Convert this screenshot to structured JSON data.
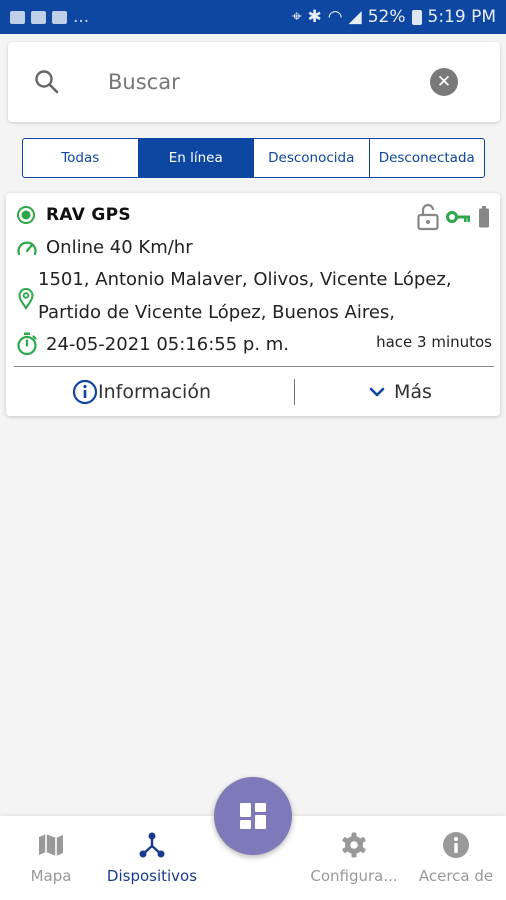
{
  "status_bar": {
    "battery": "52%",
    "time": "5:19 PM"
  },
  "search": {
    "placeholder": "Buscar"
  },
  "tabs": [
    {
      "label": "Todas"
    },
    {
      "label": "En línea"
    },
    {
      "label": "Desconocida"
    },
    {
      "label": "Desconectada"
    }
  ],
  "device": {
    "name": "RAV GPS",
    "speed_status": "Online 40 Km/hr",
    "address": "1501, Antonio Malaver, Olivos, Vicente López, Partido de Vicente López, Buenos Aires,",
    "datetime": "24-05-2021 05:16:55 p. m.",
    "ago": "hace 3 minutos",
    "info_label": "Información",
    "more_label": "Más"
  },
  "bottom_nav": {
    "items": [
      {
        "label": "Mapa",
        "icon": "map-icon"
      },
      {
        "label": "Dispositivos",
        "icon": "devices-icon"
      },
      {
        "label": "Configura...",
        "icon": "gear-icon"
      },
      {
        "label": "Acerca de",
        "icon": "info-icon"
      }
    ]
  },
  "colors": {
    "primary": "#0d47a1",
    "online_green": "#2ea64a",
    "fab": "#7e79b8"
  }
}
